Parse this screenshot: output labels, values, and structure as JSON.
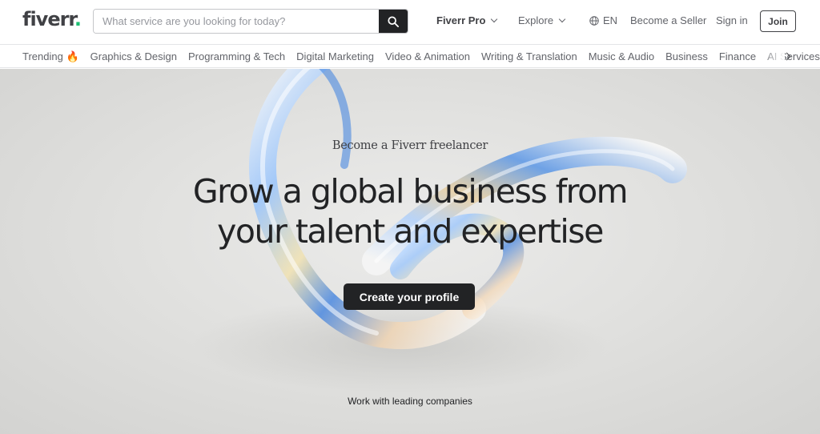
{
  "header": {
    "logo_text": "fiverr",
    "logo_dot": ".",
    "search_placeholder": "What service are you looking for today?",
    "nav": {
      "fiverr_pro": "Fiverr Pro",
      "explore": "Explore",
      "language": "EN",
      "become_seller": "Become a Seller",
      "sign_in": "Sign in",
      "join": "Join"
    }
  },
  "categories": {
    "trending": "Trending 🔥",
    "items": [
      "Graphics & Design",
      "Programming & Tech",
      "Digital Marketing",
      "Video & Animation",
      "Writing & Translation",
      "Music & Audio",
      "Business",
      "Finance",
      "AI Services"
    ]
  },
  "hero": {
    "eyebrow": "Become a Fiverr freelancer",
    "headline_line1": "Grow a global business from",
    "headline_line2": "your talent and expertise",
    "cta": "Create your profile",
    "companies": "Work with leading companies"
  },
  "colors": {
    "brand_green": "#1dbf73",
    "dark": "#222325",
    "text": "#404145"
  }
}
